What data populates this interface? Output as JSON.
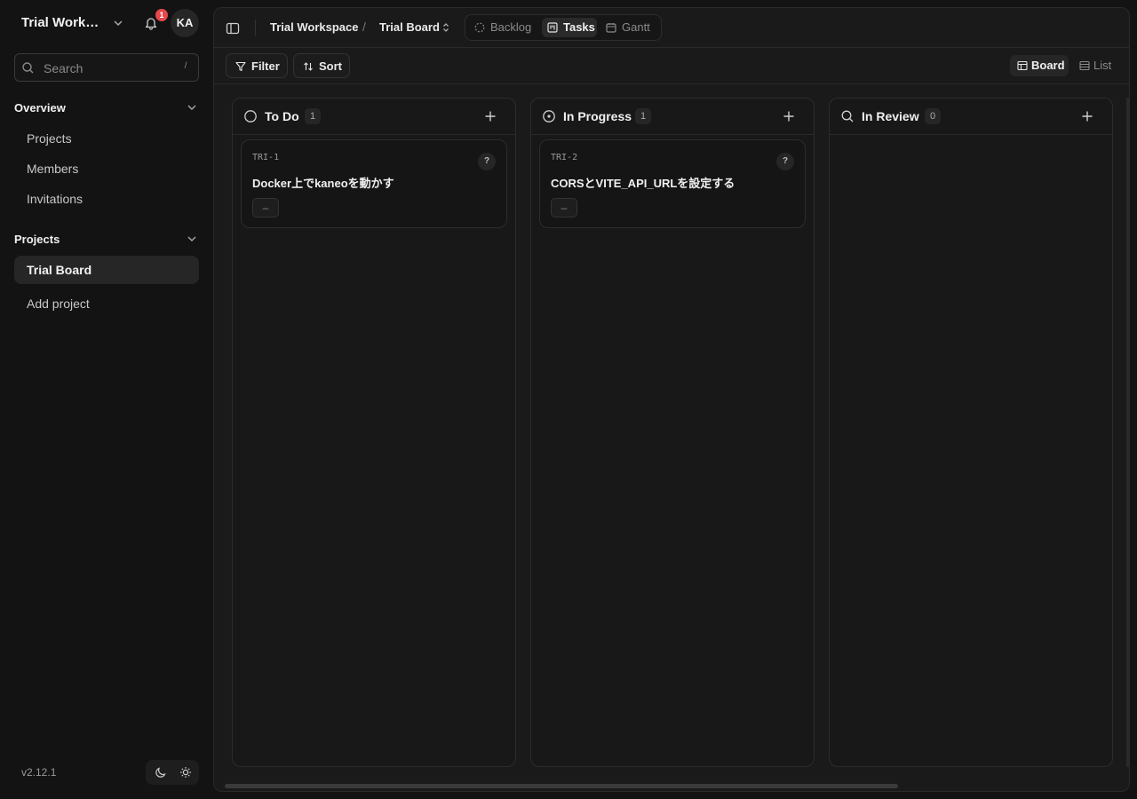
{
  "workspace": {
    "name": "Trial Workspace",
    "notification_count": "1",
    "avatar_initials": "KA"
  },
  "search": {
    "placeholder": "Search",
    "shortcut": "/"
  },
  "sidebar": {
    "overview": {
      "label": "Overview",
      "items": [
        {
          "label": "Projects"
        },
        {
          "label": "Members"
        },
        {
          "label": "Invitations"
        }
      ]
    },
    "projects": {
      "label": "Projects",
      "items": [
        {
          "label": "Trial Board",
          "active": true
        },
        {
          "label": "Add project"
        }
      ]
    },
    "version": "v2.12.1"
  },
  "breadcrumb": {
    "workspace": "Trial Workspace",
    "separator": "/",
    "project": "Trial Board"
  },
  "view_tabs": [
    {
      "label": "Backlog"
    },
    {
      "label": "Tasks",
      "active": true
    },
    {
      "label": "Gantt"
    }
  ],
  "toolbar": {
    "filter_label": "Filter",
    "sort_label": "Sort",
    "board_label": "Board",
    "list_label": "List"
  },
  "columns": [
    {
      "title": "To Do",
      "count": "1",
      "icon": "circle-icon",
      "cards": [
        {
          "id": "TRI-1",
          "title": "Docker上でkaneoを動かす",
          "help": "?",
          "priority": "–"
        }
      ]
    },
    {
      "title": "In Progress",
      "count": "1",
      "icon": "in-progress-icon",
      "cards": [
        {
          "id": "TRI-2",
          "title": "CORSとVITE_API_URLを設定する",
          "help": "?",
          "priority": "–"
        }
      ]
    },
    {
      "title": "In Review",
      "count": "0",
      "icon": "magnifier-icon",
      "cards": []
    }
  ],
  "colors": {
    "background": "#131313",
    "panel": "#1a1a1a",
    "badge": "#e5484d"
  }
}
